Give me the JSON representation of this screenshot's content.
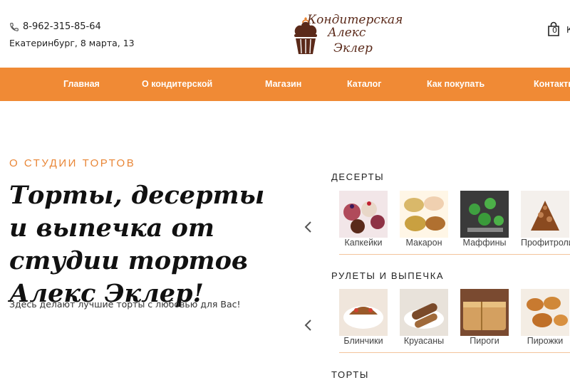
{
  "header": {
    "phone": "8-962-315-85-64",
    "address": "Екатеринбург, 8 марта, 13",
    "logo": {
      "line1": "Кондитерская",
      "line2": "Алекс",
      "line3": "Эклер"
    },
    "cart_count": "0",
    "cart_label": "К"
  },
  "nav": {
    "items": [
      {
        "label": "Главная"
      },
      {
        "label": "О кондитерской"
      },
      {
        "label": "Магазин"
      },
      {
        "label": "Каталог"
      },
      {
        "label": "Как покупать"
      },
      {
        "label": "Контакты"
      }
    ]
  },
  "hero": {
    "eyebrow": "О СТУДИИ ТОРТОВ",
    "title": "Торты, десерты и выпечка от студии тортов Алекс Эклер!",
    "subtitle": "Здесь делают лучшие торты с любовью для Вас!"
  },
  "categories": [
    {
      "title": "ДЕСЕРТЫ",
      "items": [
        {
          "label": "Капкейки",
          "color": "#b04a5a"
        },
        {
          "label": "Макарон",
          "color": "#d9b86a"
        },
        {
          "label": "Маффины",
          "color": "#3a3a3a"
        },
        {
          "label": "Профитроли",
          "color": "#8a4a20"
        }
      ]
    },
    {
      "title": "РУЛЕТЫ И ВЫПЕЧКА",
      "items": [
        {
          "label": "Блинчики",
          "color": "#9a5a2a"
        },
        {
          "label": "Круасаны",
          "color": "#7a4a2a"
        },
        {
          "label": "Пироги",
          "color": "#d4a060"
        },
        {
          "label": "Пирожки",
          "color": "#c87a30"
        }
      ]
    },
    {
      "title": "ТОРТЫ",
      "items": []
    }
  ],
  "colors": {
    "accent": "#f08a35",
    "eyebrow": "#e98636",
    "logo_brown": "#5b2a1a"
  }
}
